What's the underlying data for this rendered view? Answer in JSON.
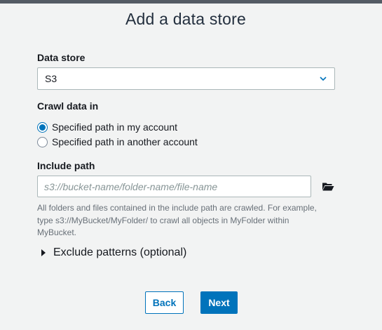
{
  "title": "Add a data store",
  "data_store": {
    "label": "Data store",
    "selected": "S3"
  },
  "crawl": {
    "label": "Crawl data in",
    "options": [
      {
        "label": "Specified path in my account",
        "checked": true
      },
      {
        "label": "Specified path in another account",
        "checked": false
      }
    ]
  },
  "include_path": {
    "label": "Include path",
    "value": "",
    "placeholder": "s3://bucket-name/folder-name/file-name",
    "help_line1": "All folders and files contained in the include path are crawled. For example,",
    "help_line2": "type s3://MyBucket/MyFolder/ to crawl all objects in MyFolder within",
    "help_line3": "MyBucket."
  },
  "exclude": {
    "label": "Exclude patterns (optional)",
    "expanded": false
  },
  "buttons": {
    "back": "Back",
    "next": "Next"
  },
  "colors": {
    "accent": "#0073bb",
    "background": "#f2f3f3",
    "topbar": "#545b64"
  },
  "icons": {
    "select": "chevron-down-icon",
    "browse": "folder-open-icon",
    "exclude": "caret-right-icon"
  }
}
